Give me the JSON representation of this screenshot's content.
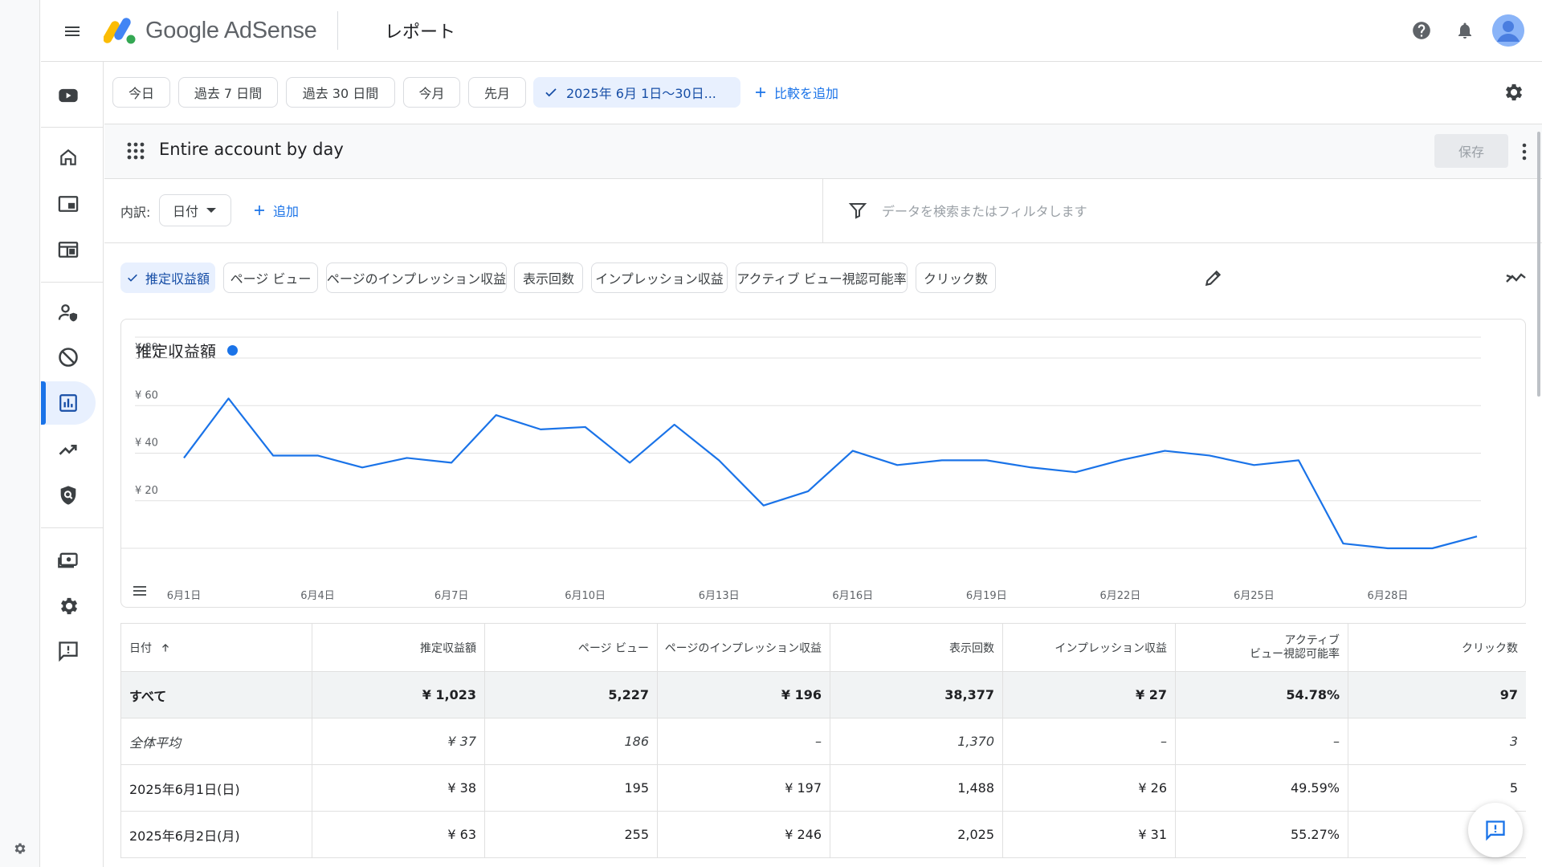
{
  "app": {
    "name": "Google AdSense",
    "page_title": "レポート"
  },
  "date_chips": [
    {
      "label": "今日"
    },
    {
      "label": "過去 7 日間"
    },
    {
      "label": "過去 30 日間"
    },
    {
      "label": "今月"
    },
    {
      "label": "先月"
    },
    {
      "label": "2025年 6月 1日～30日..."
    }
  ],
  "compare_label": "比較を追加",
  "report": {
    "name": "Entire account by day",
    "save_label": "保存"
  },
  "filterbar": {
    "breakdown_label": "内訳:",
    "dimension_value": "日付",
    "add_label": "追加",
    "filter_placeholder": "データを検索またはフィルタします"
  },
  "metric_chips": [
    {
      "label": "推定収益額"
    },
    {
      "label": "ページ ビュー"
    },
    {
      "label": "ページのインプレッション収益"
    },
    {
      "label": "表示回数"
    },
    {
      "label": "インプレッション収益"
    },
    {
      "label": "アクティブ ビュー視認可能率"
    },
    {
      "label": "クリック数"
    }
  ],
  "chart": {
    "title": "推定収益額",
    "series_color": "#1a73e8"
  },
  "chart_data": {
    "type": "line",
    "title": "推定収益額",
    "x": [
      "6月1日",
      "6月2日",
      "6月3日",
      "6月4日",
      "6月5日",
      "6月6日",
      "6月7日",
      "6月8日",
      "6月9日",
      "6月10日",
      "6月11日",
      "6月12日",
      "6月13日",
      "6月14日",
      "6月15日",
      "6月16日",
      "6月17日",
      "6月18日",
      "6月19日",
      "6月20日",
      "6月21日",
      "6月22日",
      "6月23日",
      "6月24日",
      "6月25日",
      "6月26日",
      "6月27日",
      "6月28日",
      "6月29日",
      "6月30日"
    ],
    "x_tick_labels": [
      "6月1日",
      "6月4日",
      "6月7日",
      "6月10日",
      "6月13日",
      "6月16日",
      "6月19日",
      "6月22日",
      "6月25日",
      "6月28日"
    ],
    "y_tick_labels": [
      "¥ 80",
      "¥ 60",
      "¥ 40",
      "¥ 20"
    ],
    "y_ticks": [
      80,
      60,
      40,
      20
    ],
    "ylim": [
      0,
      80
    ],
    "series": [
      {
        "values": [
          38,
          63,
          39,
          39,
          34,
          38,
          36,
          56,
          50,
          51,
          36,
          52,
          37,
          18,
          24,
          41,
          35,
          37,
          37,
          34,
          32,
          37,
          41,
          39,
          35,
          37,
          2,
          0,
          0,
          5
        ]
      }
    ],
    "grid": true,
    "legend": "none"
  },
  "table": {
    "columns": [
      {
        "label": "日付"
      },
      {
        "label": "推定収益額"
      },
      {
        "label": "ページ ビュー"
      },
      {
        "label": "ページのインプレッション収益"
      },
      {
        "label": "表示回数"
      },
      {
        "label": "インプレッション収益"
      },
      {
        "label_line1": "アクティブ",
        "label_line2": "ビュー視認可能率"
      },
      {
        "label": "クリック数"
      }
    ],
    "total": [
      "すべて",
      "¥ 1,023",
      "5,227",
      "¥ 196",
      "38,377",
      "¥ 27",
      "54.78%",
      "97"
    ],
    "average": [
      "全体平均",
      "¥ 37",
      "186",
      "–",
      "1,370",
      "–",
      "–",
      "3"
    ],
    "rows": [
      [
        "2025年6月1日(日)",
        "¥ 38",
        "195",
        "¥ 197",
        "1,488",
        "¥ 26",
        "49.59%",
        "5"
      ],
      [
        "2025年6月2日(月)",
        "¥ 63",
        "255",
        "¥ 246",
        "2,025",
        "¥ 31",
        "55.27%",
        ""
      ]
    ]
  },
  "colors": {
    "accent": "#1a73e8",
    "active_nav_bg": "#e8f0fe",
    "total_row_bg": "#f1f3f4"
  },
  "icons": {
    "menu": "hamburger-icon",
    "help": "help-icon",
    "notifications": "bell-icon",
    "account": "avatar",
    "nav": [
      "youtube-icon",
      "home-icon",
      "ads-icon",
      "sites-icon",
      "privacy-messages-icon",
      "blocking-controls-icon",
      "reports-icon",
      "optimization-icon",
      "brand-safety-icon",
      "payments-icon",
      "settings-icon",
      "feedback-icon"
    ]
  }
}
